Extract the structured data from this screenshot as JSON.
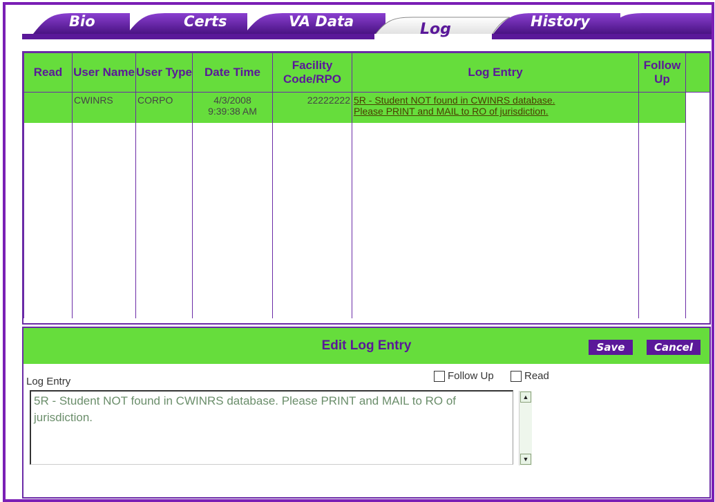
{
  "tabs": [
    {
      "label": "Bio",
      "active": false
    },
    {
      "label": "Certs",
      "active": false
    },
    {
      "label": "VA Data",
      "active": false
    },
    {
      "label": "Log",
      "active": true
    },
    {
      "label": "History",
      "active": false
    }
  ],
  "grid": {
    "columns": [
      "Read",
      "User Name",
      "User Type",
      "Date Time",
      "Facility Code/RPO",
      "Log Entry",
      "Follow Up",
      ""
    ],
    "rows": [
      {
        "read": "",
        "user_name": "CWINRS",
        "user_type": "CORPO",
        "date": "4/3/2008",
        "time": "9:39:38 AM",
        "facility": "22222222",
        "log_entry_line1": "5R - Student NOT found in CWINRS database.",
        "log_entry_line2": "Please PRINT and MAIL to RO of jurisdiction.",
        "follow_up": ""
      }
    ]
  },
  "edit": {
    "title": "Edit Log Entry",
    "save_label": "Save",
    "cancel_label": "Cancel",
    "log_entry_label": "Log Entry",
    "follow_up_label": "Follow Up",
    "read_label": "Read",
    "follow_up_checked": false,
    "read_checked": false,
    "log_text": "5R - Student NOT found in CWINRS database. Please PRINT and MAIL to RO of jurisdiction."
  },
  "colors": {
    "frame": "#7a1fb5",
    "tab_purple": "#5a1899",
    "header_green": "#66dd3c",
    "text_purple": "#5a1899"
  }
}
